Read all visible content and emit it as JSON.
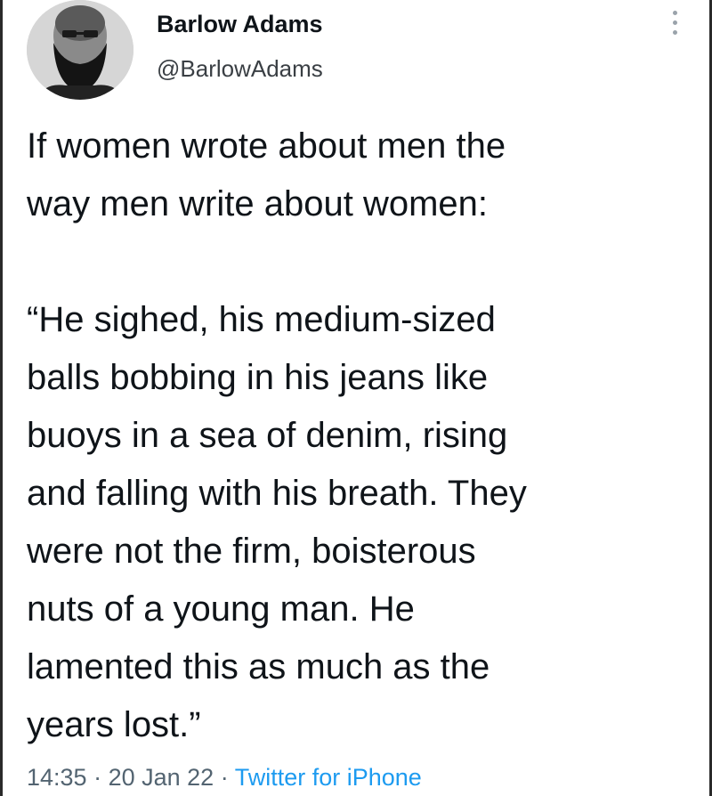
{
  "author": {
    "display_name": "Barlow Adams",
    "handle": "@BarlowAdams"
  },
  "tweet": {
    "intro_lines": [
      "If women wrote about men the",
      "way men write about women:"
    ],
    "quote_lines": [
      "“He sighed, his medium-sized",
      "balls bobbing in his jeans like",
      "buoys in a sea of denim, rising",
      "and falling with his breath. They",
      "were not the firm, boisterous",
      "nuts of a young man. He",
      "lamented this as much as the",
      "years lost.”"
    ]
  },
  "meta": {
    "time": "14:35",
    "separator": " · ",
    "date": "20 Jan 22",
    "source": "Twitter for iPhone"
  },
  "icons": {
    "more": "more-vertical-icon"
  },
  "colors": {
    "text": "#0f1419",
    "secondary": "#536471",
    "link": "#1d9bf0"
  }
}
